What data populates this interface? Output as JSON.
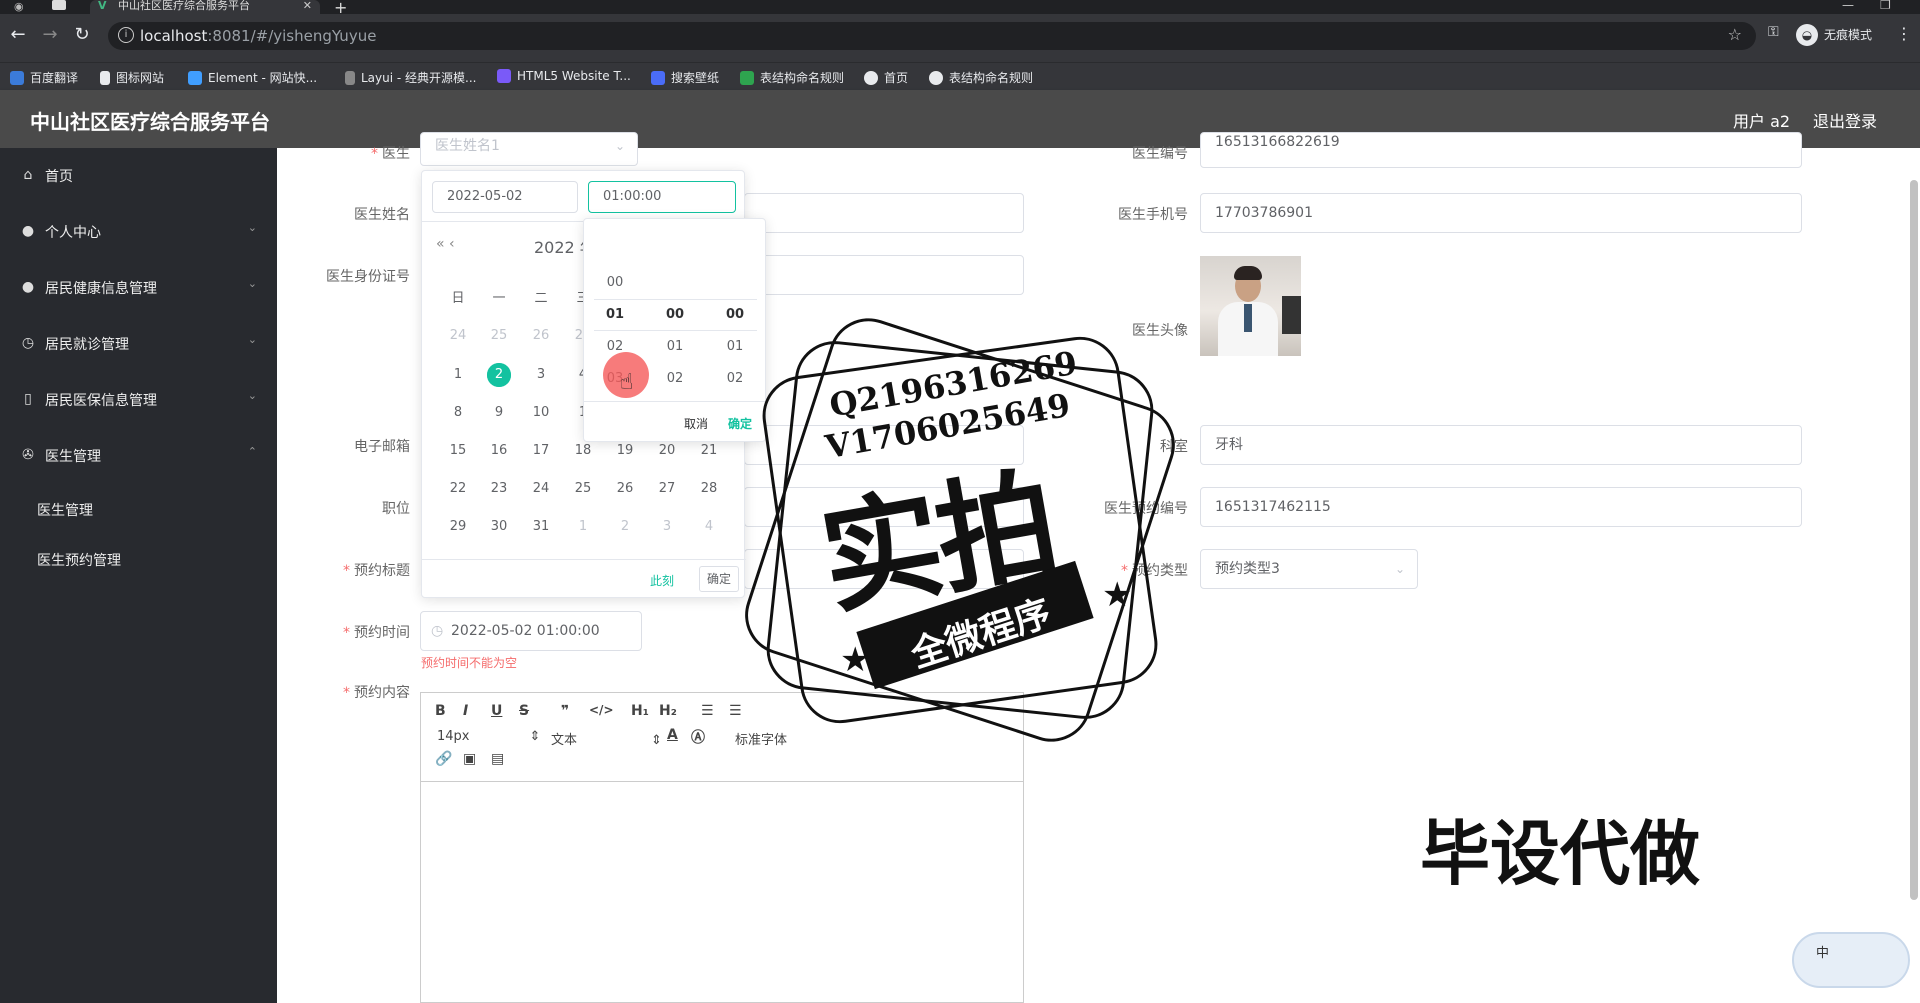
{
  "browser": {
    "tab_title": "中山社区医疗综合服务平台",
    "tab_icon": "V",
    "url_host": "localhost",
    "url_rest": ":8081/#/yishengYuyue",
    "profile_label": "无痕模式",
    "bookmarks": [
      "百度翻译",
      "图标网站",
      "Element - 网站快...",
      "Layui - 经典开源模...",
      "HTML5 Website T...",
      "搜索壁纸",
      "表结构命名规则",
      "首页",
      "表结构命名规则"
    ]
  },
  "header": {
    "title": "中山社区医疗综合服务平台",
    "user": "用户 a2",
    "logout": "退出登录"
  },
  "sidebar": {
    "items": [
      {
        "label": "首页"
      },
      {
        "label": "个人中心"
      },
      {
        "label": "居民健康信息管理"
      },
      {
        "label": "居民就诊管理"
      },
      {
        "label": "居民医保信息管理"
      },
      {
        "label": "医生管理"
      }
    ],
    "sub_items": [
      "医生管理",
      "医生预约管理"
    ]
  },
  "form": {
    "doctor_label": "医生",
    "doctor_value": "医生姓名1",
    "doctor_name_label": "医生姓名",
    "doctor_id_label": "医生身份证号",
    "email_label": "电子邮箱",
    "title_label": "职位",
    "appointment_title_label": "预约标题",
    "appointment_time_label": "预约时间",
    "appointment_time_value": "2022-05-02 01:00:00",
    "appointment_time_error": "预约时间不能为空",
    "appointment_content_label": "预约内容",
    "doctor_no_label": "医生编号",
    "doctor_no_value": "16513166822619",
    "doctor_phone_label": "医生手机号",
    "doctor_phone_value": "17703786901",
    "doctor_avatar_label": "医生头像",
    "dept_label": "科室",
    "dept_value": "牙科",
    "booking_no_label": "医生预约编号",
    "booking_no_value": "1651317462115",
    "booking_type_label": "预约类型",
    "booking_type_value": "预约类型3"
  },
  "editor": {
    "font_size": "14px",
    "text_style": "文本",
    "font_family": "标准字体"
  },
  "datepicker": {
    "date_value": "2022-05-02",
    "time_value": "01:00:00",
    "year_label": "2022 年",
    "nav_prev": "« ‹",
    "weekdays": [
      "日",
      "一",
      "二",
      "三"
    ],
    "rows": [
      [
        "24",
        "25",
        "26",
        "27"
      ],
      [
        "1",
        "2",
        "3",
        "4"
      ],
      [
        "8",
        "9",
        "10",
        "1"
      ],
      [
        "15",
        "16",
        "17",
        "18",
        "19",
        "20",
        "21"
      ],
      [
        "22",
        "23",
        "24",
        "25",
        "26",
        "27",
        "28"
      ],
      [
        "29",
        "30",
        "31",
        "1",
        "2",
        "3",
        "4"
      ]
    ],
    "now_label": "此刻",
    "ok_label": "确定",
    "time_hours": [
      "00",
      "01",
      "02",
      "03"
    ],
    "time_minutes": [
      "00",
      "01",
      "02"
    ],
    "time_seconds": [
      "00",
      "01",
      "02"
    ],
    "cancel_label": "取消",
    "confirm_label": "确定"
  },
  "watermark": {
    "qq": "Q2196316269",
    "vx": "V1706025649",
    "big_text": "实拍",
    "ribbon_text": "全微程序",
    "side_text": "毕设代做"
  },
  "widget_text": "中"
}
